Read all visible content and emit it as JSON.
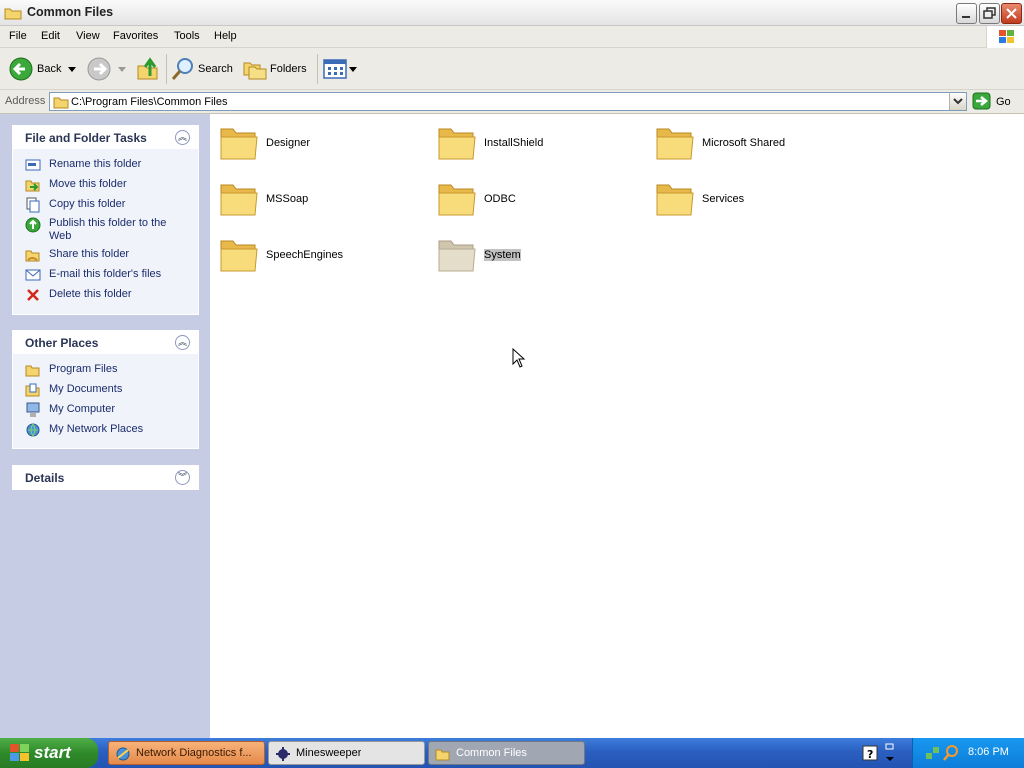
{
  "window": {
    "title": "Common Files"
  },
  "menu": [
    "File",
    "Edit",
    "View",
    "Favorites",
    "Tools",
    "Help"
  ],
  "toolbar": {
    "back_label": "Back",
    "search_label": "Search",
    "folders_label": "Folders"
  },
  "address": {
    "label": "Address",
    "value": "C:\\Program Files\\Common Files",
    "go_label": "Go"
  },
  "tasks_panel": {
    "title": "File and Folder Tasks",
    "items": [
      {
        "label": "Rename this folder",
        "icon": "rename-icon"
      },
      {
        "label": "Move this folder",
        "icon": "move-icon"
      },
      {
        "label": "Copy this folder",
        "icon": "copy-icon"
      },
      {
        "label": "Publish this folder to the Web",
        "icon": "publish-web-icon"
      },
      {
        "label": "Share this folder",
        "icon": "share-icon"
      },
      {
        "label": "E-mail this folder's files",
        "icon": "email-icon"
      },
      {
        "label": "Delete this folder",
        "icon": "delete-icon"
      }
    ]
  },
  "places_panel": {
    "title": "Other Places",
    "items": [
      {
        "label": "Program Files",
        "icon": "folder-icon"
      },
      {
        "label": "My Documents",
        "icon": "my-documents-icon"
      },
      {
        "label": "My Computer",
        "icon": "my-computer-icon"
      },
      {
        "label": "My Network Places",
        "icon": "network-places-icon"
      }
    ]
  },
  "details_panel": {
    "title": "Details"
  },
  "folders": [
    {
      "name": "Designer"
    },
    {
      "name": "InstallShield"
    },
    {
      "name": "Microsoft Shared"
    },
    {
      "name": "MSSoap"
    },
    {
      "name": "ODBC"
    },
    {
      "name": "Services"
    },
    {
      "name": "SpeechEngines"
    },
    {
      "name": "System",
      "selected": true
    }
  ],
  "taskbar": {
    "start_label": "start",
    "buttons": [
      {
        "label": "Network Diagnostics f..."
      },
      {
        "label": "Minesweeper"
      },
      {
        "label": "Common Files",
        "active": true
      }
    ],
    "clock": "8:06 PM"
  },
  "colors": {
    "folder_yellow": "#f5d76e",
    "link_blue": "#1a2d6b",
    "taskbar_blue": "#2a5fc0",
    "start_green": "#2f8a2a"
  }
}
